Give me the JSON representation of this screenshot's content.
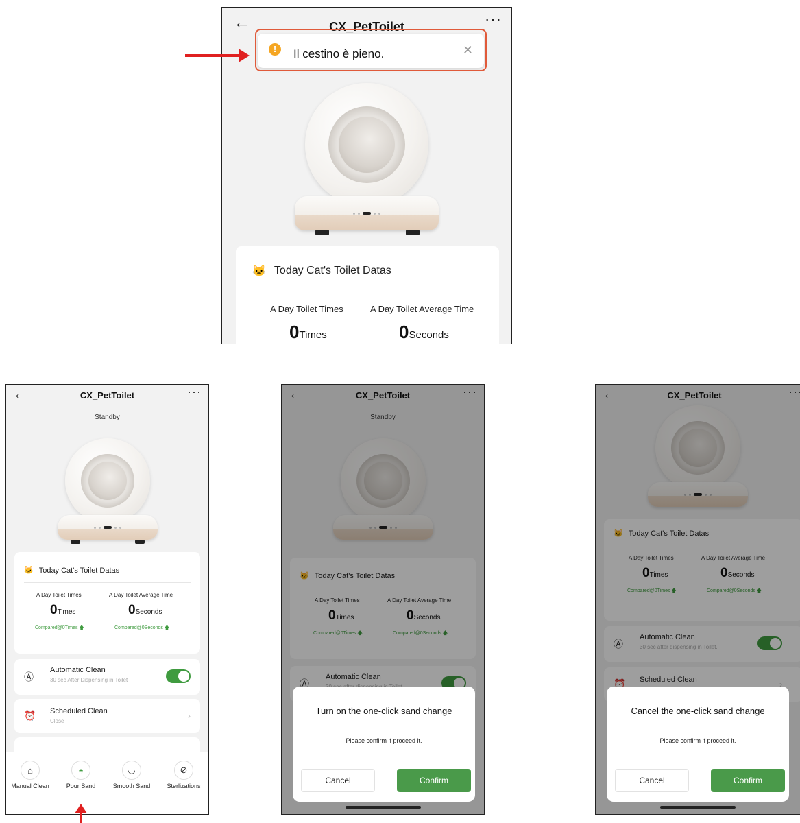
{
  "app": {
    "title": "CX_PetToilet",
    "back_icon": "arrow-left-icon",
    "more_icon": "more-dots-icon",
    "status": "Standby"
  },
  "toast": {
    "icon": "warning-icon",
    "message": "Il cestino è pieno.",
    "close_icon": "close-icon",
    "highlight_color": "#e05a3a"
  },
  "stats_card": {
    "title": "Today Cat's Toilet Datas",
    "times_label": "A Day Toilet Times",
    "avg_label": "A Day Toilet Average Time",
    "times_value": "0",
    "times_unit": "Times",
    "avg_value": "0",
    "avg_unit": "Seconds",
    "times_compared_a": "Compared@0Times",
    "avg_compared_a": "Compared@0Seconds",
    "times_compared_b": "Compared@0Times",
    "avg_compared_b": "Compared@0Seconds"
  },
  "settings": {
    "auto_clean": {
      "title": "Automatic Clean",
      "subtitle_a": "30 sec After Dispensing in Toilet",
      "subtitle_b": "30 sec after dispensing in Toilet.",
      "enabled": true
    },
    "scheduled_clean": {
      "title": "Scheduled Clean",
      "subtitle": "Close"
    }
  },
  "actions": [
    {
      "label": "Manual Clean",
      "icon": "broom-icon"
    },
    {
      "label": "Pour Sand",
      "icon": "sand-pour-icon"
    },
    {
      "label": "Smooth Sand",
      "icon": "smooth-sand-icon"
    },
    {
      "label": "Sterlizations",
      "icon": "sterilize-icon"
    }
  ],
  "dialog_on": {
    "title": "Turn on the one-click sand change",
    "message": "Please confirm if proceed it.",
    "cancel": "Cancel",
    "confirm": "Confirm"
  },
  "dialog_cancel": {
    "title": "Cancel the one-click sand change",
    "message": "Please confirm if proceed it.",
    "cancel": "Cancel",
    "confirm": "Confirm"
  },
  "colors": {
    "accent_green": "#4a9a4a",
    "warning": "#f5a623",
    "annotation_red": "#e02020"
  }
}
